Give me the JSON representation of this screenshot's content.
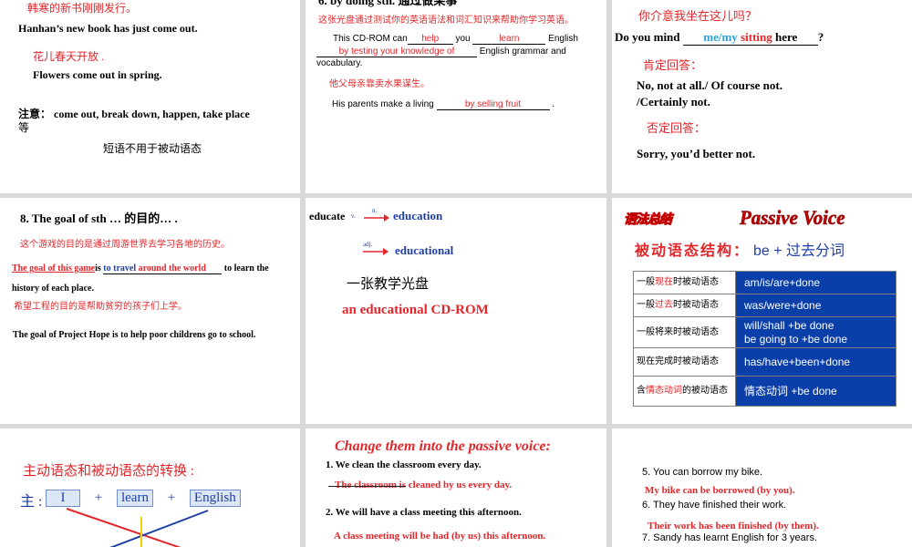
{
  "slide1": {
    "line1_cn": "韩寒的新书刚刚发行。",
    "line2_en": "Hanhan’s new book has just come out.",
    "line3_cn": "花儿春天开放 .",
    "line4_en": "Flowers come out in spring.",
    "note_label": "注意：",
    "note_text": "come out, break down, happen, take place",
    "note_tail": "等",
    "note_sub": "短语不用于被动语态"
  },
  "slide2": {
    "heading": "6. by doing sth. 通过做某事",
    "sent1_cn": "这张光盘通过测试你的英语语法和词汇知识来帮助你学习英语。",
    "sent1_a": "This CD-ROM can",
    "sent1_b1": "help",
    "sent1_c": "you",
    "sent1_b2": "learn",
    "sent1_d": "English",
    "sent1_b3": "by testing your knowledge of",
    "sent1_e": "English grammar and",
    "sent1_f": "vocabulary.",
    "sent2_cn": "他父母亲靠卖水果谋生。",
    "sent2_a": "His parents make a living",
    "sent2_b": "by  selling fruit",
    "sent2_c": "."
  },
  "slide3": {
    "q_cn": "你介意我坐在这儿吗？",
    "q_a": "Do you mind",
    "q_blank": "me/my",
    "q_blank2": "sitting",
    "q_here": "here",
    "q_end": "?",
    "pos_label": "肯定回答：",
    "pos_1": "No, not at all./ Of course not.",
    "pos_2": "/Certainly not.",
    "neg_label": "否定回答：",
    "neg_1": "Sorry, you’d better not."
  },
  "slide4": {
    "heading": "8. The goal of sth … 的目的… .",
    "cn1": "这个游戏的目的是通过周游世界去学习各地的历史。",
    "b1": "The goal of this game",
    "is": "is",
    "b2": "to travel",
    "b3": "around the world",
    "tail1": "to learn the",
    "tail2": "history of each place.",
    "cn2": "希望工程的目的是帮助贫穷的孩子们上学。",
    "en2": "The goal of Project Hope is to help poor childrens go to school."
  },
  "slide5": {
    "educate": "educate",
    "v": "v.",
    "n": "n.",
    "education": "education",
    "adj": "adj.",
    "educational": "educational",
    "cn": "一张教学光盘",
    "en": "an educational CD-ROM"
  },
  "slide6": {
    "badge": "语法总结",
    "title": "Passive Voice",
    "struct_label": "被动语态结构：",
    "struct_formula": "be + 过去分词",
    "rows": [
      {
        "l_pre": "一般",
        "l_hl": "现在",
        "l_post": "时被动语态",
        "r": "am/is/are+done"
      },
      {
        "l_pre": "一般",
        "l_hl": "过去",
        "l_post": "时被动语态",
        "r": "was/were+done"
      },
      {
        "l_pre": "一般将来时被动语态",
        "l_hl": "",
        "l_post": "",
        "r": "will/shall +be done\nbe going to +be done"
      },
      {
        "l_pre": "现在完成时被动语态",
        "l_hl": "",
        "l_post": "",
        "r": "has/have+been+done"
      },
      {
        "l_pre": "含",
        "l_hl": "情态动词",
        "l_post": "的被动语态",
        "r": "情态动词 +be done"
      }
    ]
  },
  "slide7": {
    "title": "主动语态和被动语态的转换 :",
    "subj_label": "主 :",
    "w1": "I",
    "plus1": "+",
    "w2": "learn",
    "plus2": "+",
    "w3": "English"
  },
  "slide8": {
    "title": "Change them into the passive voice:",
    "s1": "1. We clean the classroom every day.",
    "a1": "The classroom is cleaned by us every day.",
    "s2": "2. We will have a class meeting this afternoon.",
    "a2": "A class meeting will be had (by us) this afternoon."
  },
  "slide9": {
    "s5": "5. You can borrow my bike.",
    "a5": "My bike can be borrowed (by you).",
    "s6": "6. They have finished their work.",
    "a6": "Their work has been finished (by them).",
    "s7": "7. Sandy has learnt English for 3 years."
  },
  "colors": {
    "red": "#e3262a",
    "blue": "#1f3fa8",
    "table_blue": "#0a3ea8",
    "cyan": "#2aa0d8",
    "gap": "#d9d9d9"
  }
}
